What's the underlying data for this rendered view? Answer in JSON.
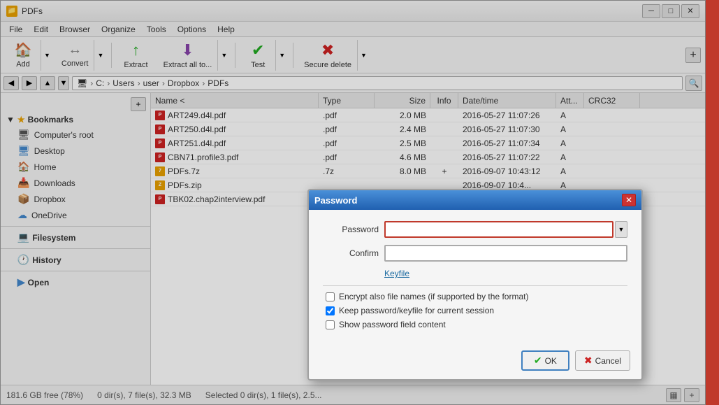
{
  "window": {
    "title": "PDFs",
    "icon": "📁"
  },
  "menu": {
    "items": [
      "File",
      "Edit",
      "Browser",
      "Organize",
      "Tools",
      "Options",
      "Help"
    ]
  },
  "toolbar": {
    "buttons": [
      {
        "id": "add",
        "label": "Add",
        "icon": "🏠"
      },
      {
        "id": "convert",
        "label": "Convert",
        "icon": "🔄"
      },
      {
        "id": "extract",
        "label": "Extract",
        "icon": "📤"
      },
      {
        "id": "extract-all",
        "label": "Extract all to...",
        "icon": "📥"
      },
      {
        "id": "test",
        "label": "Test",
        "icon": "✅"
      },
      {
        "id": "secure-delete",
        "label": "Secure delete",
        "icon": "❌"
      }
    ]
  },
  "address_bar": {
    "path_parts": [
      "C:",
      "Users",
      "user",
      "Dropbox",
      "PDFs"
    ]
  },
  "sidebar": {
    "bookmarks_label": "Bookmarks",
    "items": [
      {
        "id": "computer-root",
        "label": "Computer's root"
      },
      {
        "id": "desktop",
        "label": "Desktop"
      },
      {
        "id": "home",
        "label": "Home"
      },
      {
        "id": "downloads",
        "label": "Downloads"
      },
      {
        "id": "dropbox",
        "label": "Dropbox"
      },
      {
        "id": "onedrive",
        "label": "OneDrive"
      }
    ],
    "filesystem_label": "Filesystem",
    "history_label": "History",
    "open_label": "Open"
  },
  "file_list": {
    "columns": [
      "Name",
      "Type",
      "Size",
      "Info",
      "Date/time",
      "Att...",
      "CRC32"
    ],
    "files": [
      {
        "name": "ART249.d4l.pdf",
        "type": ".pdf",
        "size": "2.0 MB",
        "info": "",
        "datetime": "2016-05-27 11:07:26",
        "attr": "A",
        "crc": ""
      },
      {
        "name": "ART250.d4l.pdf",
        "type": ".pdf",
        "size": "2.4 MB",
        "info": "",
        "datetime": "2016-05-27 11:07:30",
        "attr": "A",
        "crc": ""
      },
      {
        "name": "ART251.d4l.pdf",
        "type": ".pdf",
        "size": "2.5 MB",
        "info": "",
        "datetime": "2016-05-27 11:07:34",
        "attr": "A",
        "crc": ""
      },
      {
        "name": "CBN71.profile3.pdf",
        "type": ".pdf",
        "size": "4.6 MB",
        "info": "",
        "datetime": "2016-05-27 11:07:22",
        "attr": "A",
        "crc": ""
      },
      {
        "name": "PDFs.7z",
        "type": ".7z",
        "size": "8.0 MB",
        "info": "+",
        "datetime": "2016-09-07 10:43:12",
        "attr": "A",
        "crc": ""
      },
      {
        "name": "PDFs.zip",
        "type": "",
        "size": "",
        "info": "",
        "datetime": "2016-09-07 10:4...",
        "attr": "A",
        "crc": ""
      },
      {
        "name": "TBK02.chap2interview.pdf",
        "type": ".pdf",
        "size": "",
        "info": "",
        "datetime": "",
        "attr": "",
        "crc": ""
      }
    ]
  },
  "status_bar": {
    "disk_info": "181.6 GB free (78%)",
    "dir_info": "0 dir(s), 7 file(s), 32.3 MB",
    "selected_info": "Selected 0 dir(s), 1 file(s), 2.5..."
  },
  "password_dialog": {
    "title": "Password",
    "password_label": "Password",
    "confirm_label": "Confirm",
    "keyfile_label": "Keyfile",
    "checkboxes": [
      {
        "id": "encrypt-names",
        "label": "Encrypt also file names (if supported by the format)",
        "checked": false
      },
      {
        "id": "keep-password",
        "label": "Keep password/keyfile for current session",
        "checked": true
      },
      {
        "id": "show-content",
        "label": "Show password field content",
        "checked": false
      }
    ],
    "ok_label": "OK",
    "cancel_label": "Cancel"
  }
}
